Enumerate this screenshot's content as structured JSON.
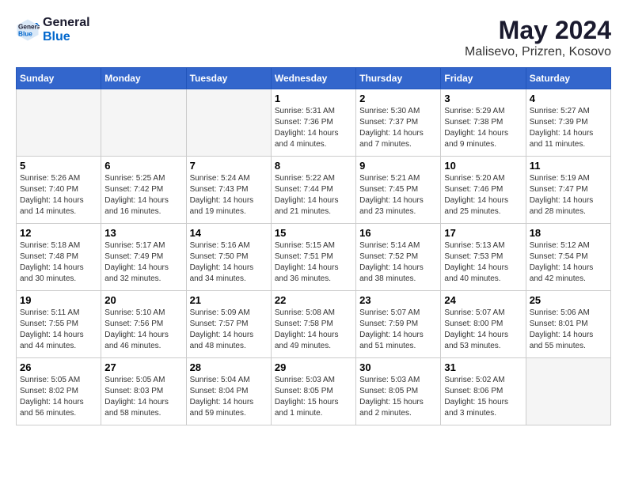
{
  "header": {
    "logo_line1": "General",
    "logo_line2": "Blue",
    "month_title": "May 2024",
    "location": "Malisevo, Prizren, Kosovo"
  },
  "weekdays": [
    "Sunday",
    "Monday",
    "Tuesday",
    "Wednesday",
    "Thursday",
    "Friday",
    "Saturday"
  ],
  "weeks": [
    [
      {
        "day": "",
        "info": ""
      },
      {
        "day": "",
        "info": ""
      },
      {
        "day": "",
        "info": ""
      },
      {
        "day": "1",
        "info": "Sunrise: 5:31 AM\nSunset: 7:36 PM\nDaylight: 14 hours\nand 4 minutes."
      },
      {
        "day": "2",
        "info": "Sunrise: 5:30 AM\nSunset: 7:37 PM\nDaylight: 14 hours\nand 7 minutes."
      },
      {
        "day": "3",
        "info": "Sunrise: 5:29 AM\nSunset: 7:38 PM\nDaylight: 14 hours\nand 9 minutes."
      },
      {
        "day": "4",
        "info": "Sunrise: 5:27 AM\nSunset: 7:39 PM\nDaylight: 14 hours\nand 11 minutes."
      }
    ],
    [
      {
        "day": "5",
        "info": "Sunrise: 5:26 AM\nSunset: 7:40 PM\nDaylight: 14 hours\nand 14 minutes."
      },
      {
        "day": "6",
        "info": "Sunrise: 5:25 AM\nSunset: 7:42 PM\nDaylight: 14 hours\nand 16 minutes."
      },
      {
        "day": "7",
        "info": "Sunrise: 5:24 AM\nSunset: 7:43 PM\nDaylight: 14 hours\nand 19 minutes."
      },
      {
        "day": "8",
        "info": "Sunrise: 5:22 AM\nSunset: 7:44 PM\nDaylight: 14 hours\nand 21 minutes."
      },
      {
        "day": "9",
        "info": "Sunrise: 5:21 AM\nSunset: 7:45 PM\nDaylight: 14 hours\nand 23 minutes."
      },
      {
        "day": "10",
        "info": "Sunrise: 5:20 AM\nSunset: 7:46 PM\nDaylight: 14 hours\nand 25 minutes."
      },
      {
        "day": "11",
        "info": "Sunrise: 5:19 AM\nSunset: 7:47 PM\nDaylight: 14 hours\nand 28 minutes."
      }
    ],
    [
      {
        "day": "12",
        "info": "Sunrise: 5:18 AM\nSunset: 7:48 PM\nDaylight: 14 hours\nand 30 minutes."
      },
      {
        "day": "13",
        "info": "Sunrise: 5:17 AM\nSunset: 7:49 PM\nDaylight: 14 hours\nand 32 minutes."
      },
      {
        "day": "14",
        "info": "Sunrise: 5:16 AM\nSunset: 7:50 PM\nDaylight: 14 hours\nand 34 minutes."
      },
      {
        "day": "15",
        "info": "Sunrise: 5:15 AM\nSunset: 7:51 PM\nDaylight: 14 hours\nand 36 minutes."
      },
      {
        "day": "16",
        "info": "Sunrise: 5:14 AM\nSunset: 7:52 PM\nDaylight: 14 hours\nand 38 minutes."
      },
      {
        "day": "17",
        "info": "Sunrise: 5:13 AM\nSunset: 7:53 PM\nDaylight: 14 hours\nand 40 minutes."
      },
      {
        "day": "18",
        "info": "Sunrise: 5:12 AM\nSunset: 7:54 PM\nDaylight: 14 hours\nand 42 minutes."
      }
    ],
    [
      {
        "day": "19",
        "info": "Sunrise: 5:11 AM\nSunset: 7:55 PM\nDaylight: 14 hours\nand 44 minutes."
      },
      {
        "day": "20",
        "info": "Sunrise: 5:10 AM\nSunset: 7:56 PM\nDaylight: 14 hours\nand 46 minutes."
      },
      {
        "day": "21",
        "info": "Sunrise: 5:09 AM\nSunset: 7:57 PM\nDaylight: 14 hours\nand 48 minutes."
      },
      {
        "day": "22",
        "info": "Sunrise: 5:08 AM\nSunset: 7:58 PM\nDaylight: 14 hours\nand 49 minutes."
      },
      {
        "day": "23",
        "info": "Sunrise: 5:07 AM\nSunset: 7:59 PM\nDaylight: 14 hours\nand 51 minutes."
      },
      {
        "day": "24",
        "info": "Sunrise: 5:07 AM\nSunset: 8:00 PM\nDaylight: 14 hours\nand 53 minutes."
      },
      {
        "day": "25",
        "info": "Sunrise: 5:06 AM\nSunset: 8:01 PM\nDaylight: 14 hours\nand 55 minutes."
      }
    ],
    [
      {
        "day": "26",
        "info": "Sunrise: 5:05 AM\nSunset: 8:02 PM\nDaylight: 14 hours\nand 56 minutes."
      },
      {
        "day": "27",
        "info": "Sunrise: 5:05 AM\nSunset: 8:03 PM\nDaylight: 14 hours\nand 58 minutes."
      },
      {
        "day": "28",
        "info": "Sunrise: 5:04 AM\nSunset: 8:04 PM\nDaylight: 14 hours\nand 59 minutes."
      },
      {
        "day": "29",
        "info": "Sunrise: 5:03 AM\nSunset: 8:05 PM\nDaylight: 15 hours\nand 1 minute."
      },
      {
        "day": "30",
        "info": "Sunrise: 5:03 AM\nSunset: 8:05 PM\nDaylight: 15 hours\nand 2 minutes."
      },
      {
        "day": "31",
        "info": "Sunrise: 5:02 AM\nSunset: 8:06 PM\nDaylight: 15 hours\nand 3 minutes."
      },
      {
        "day": "",
        "info": ""
      }
    ]
  ]
}
